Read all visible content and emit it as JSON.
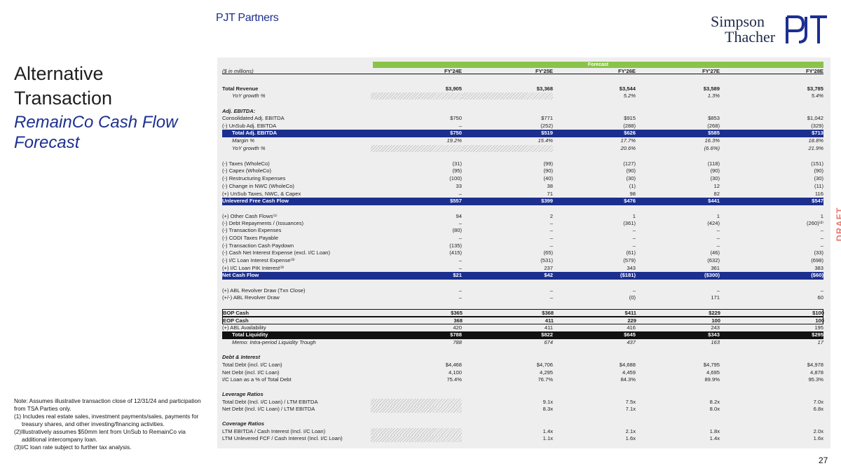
{
  "brand": {
    "pjt_name": "PJT Partners",
    "st_line1": "Simpson",
    "st_line2": "Thacher"
  },
  "heading": {
    "title": "Alternative Transaction",
    "subtitle": "RemainCo Cash Flow Forecast"
  },
  "draft": "DRAFT",
  "page_number": "27",
  "notes": {
    "intro": "Note: Assumes illustrative transaction close of 12/31/24 and participation from TSA Parties only.",
    "items": [
      "(1) Includes real estate sales, investment payments/sales, payments for treasury shares, and other investing/financing activities.",
      "(2)Illustratively assumes $50mm lent from UnSub to RemainCo via additional intercompany loan.",
      "(3)I/C loan rate subject to further tax analysis."
    ]
  },
  "table": {
    "forecast_label": "Forecast",
    "header": [
      "($ in millions)",
      "FY'24E",
      "FY'25E",
      "FY'26E",
      "FY'27E",
      "FY'28E"
    ],
    "rows": [
      {
        "label": "Total Revenue",
        "v": [
          "$3,905",
          "$3,368",
          "$3,544",
          "$3,589",
          "$3,785"
        ],
        "style": "bold"
      },
      {
        "label": "YoY growth %",
        "v": [
          "",
          "",
          "5.2%",
          "1.3%",
          "5.4%"
        ],
        "style": "italic-indent",
        "hatch": [
          0,
          1
        ]
      },
      {
        "label": "Adj. EBITDA:",
        "v": [
          "",
          "",
          "",
          "",
          ""
        ],
        "style": "bold-italic"
      },
      {
        "label": "Consolidated Adj. EBITDA",
        "v": [
          "$750",
          "$771",
          "$915",
          "$853",
          "$1,042"
        ]
      },
      {
        "label": "(-) UnSub Adj. EBITDA",
        "v": [
          "–",
          "(252)",
          "(288)",
          "(268)",
          "(329)"
        ]
      },
      {
        "label": "Total Adj. EBITDA",
        "v": [
          "$750",
          "$519",
          "$626",
          "$585",
          "$713"
        ],
        "style": "blue-indent"
      },
      {
        "label": "Margin %",
        "v": [
          "19.2%",
          "15.4%",
          "17.7%",
          "16.3%",
          "18.8%"
        ],
        "style": "italic-indent"
      },
      {
        "label": "YoY growth %",
        "v": [
          "",
          "",
          "20.6%",
          "(6.6%)",
          "21.9%"
        ],
        "style": "italic-indent",
        "hatch": [
          0,
          1
        ]
      },
      {
        "label": "(-) Taxes (WholeCo)",
        "v": [
          "(31)",
          "(99)",
          "(127)",
          "(118)",
          "(151)"
        ]
      },
      {
        "label": "(-) Capex (WholeCo)",
        "v": [
          "(95)",
          "(90)",
          "(90)",
          "(90)",
          "(90)"
        ]
      },
      {
        "label": "(-) Restructuring Expenses",
        "v": [
          "(100)",
          "(40)",
          "(30)",
          "(30)",
          "(30)"
        ]
      },
      {
        "label": "(-) Change in NWC (WholeCo)",
        "v": [
          "33",
          "38",
          "(1)",
          "12",
          "(11)"
        ]
      },
      {
        "label": "(+) UnSub Taxes, NWC, & Capex",
        "v": [
          "–",
          "71",
          "98",
          "82",
          "116"
        ]
      },
      {
        "label": "Unlevered Free Cash Flow",
        "v": [
          "$557",
          "$399",
          "$476",
          "$441",
          "$547"
        ],
        "style": "blue"
      },
      {
        "label": "(+) Other Cash Flows⁽¹⁾",
        "v": [
          "94",
          "2",
          "1",
          "1",
          "1"
        ]
      },
      {
        "label": "(-) Debt Repayments / (Issuances)",
        "v": [
          "–",
          "–",
          "(361)",
          "(424)",
          "(260)⁽²⁾"
        ]
      },
      {
        "label": "(-) Transaction Expenses",
        "v": [
          "(80)",
          "–",
          "–",
          "–",
          "–"
        ]
      },
      {
        "label": "(-) CODI Taxes Payable",
        "v": [
          "–",
          "–",
          "–",
          "–",
          "–"
        ]
      },
      {
        "label": "(-) Transaction Cash Paydown",
        "v": [
          "(135)",
          "–",
          "–",
          "–",
          "–"
        ]
      },
      {
        "label": "(-) Cash Net Interest Expense (excl. I/C Loan)",
        "v": [
          "(415)",
          "(65)",
          "(61)",
          "(46)",
          "(33)"
        ]
      },
      {
        "label": "(-) I/C Loan Interest Expense⁽³⁾",
        "v": [
          "–",
          "(531)",
          "(579)",
          "(632)",
          "(698)"
        ]
      },
      {
        "label": "(+) I/C Loan PIK Interest⁽³⁾",
        "v": [
          "–",
          "237",
          "343",
          "361",
          "383"
        ]
      },
      {
        "label": "Net Cash Flow",
        "v": [
          "$21",
          "$42",
          "($181)",
          "($300)",
          "($60)"
        ],
        "style": "blue"
      },
      {
        "label": "(+) ABL Revolver Draw (Txn Close)",
        "v": [
          "–",
          "–",
          "–",
          "–",
          "–"
        ]
      },
      {
        "label": "(+/-) ABL Revolver Draw",
        "v": [
          "–",
          "–",
          "(0)",
          "171",
          "60"
        ]
      },
      {
        "label": "BOP Cash",
        "v": [
          "$365",
          "$368",
          "$411",
          "$229",
          "$100"
        ],
        "style": "boxed"
      },
      {
        "label": "EOP Cash",
        "v": [
          "368",
          "411",
          "229",
          "100",
          "100"
        ],
        "style": "boxed"
      },
      {
        "label": "(+) ABL Availability",
        "v": [
          "420",
          "411",
          "416",
          "243",
          "195"
        ]
      },
      {
        "label": "Total Liquidity",
        "v": [
          "$788",
          "$822",
          "$645",
          "$343",
          "$295"
        ],
        "style": "black-indent"
      },
      {
        "label": "Memo: Intra-period Liquidity Trough",
        "v": [
          "788",
          "674",
          "437",
          "163",
          "17"
        ],
        "style": "italic-indent"
      },
      {
        "label": "Debt & Interest",
        "v": [
          "",
          "",
          "",
          "",
          ""
        ],
        "style": "bold-italic"
      },
      {
        "label": "Total Debt (incl. I/C Loan)",
        "v": [
          "$4,468",
          "$4,706",
          "$4,688",
          "$4,795",
          "$4,978"
        ]
      },
      {
        "label": "Net Debt (incl. I/C Loan)",
        "v": [
          "4,100",
          "4,295",
          "4,459",
          "4,695",
          "4,878"
        ]
      },
      {
        "label": "I/C Loan as a % of Total Debt",
        "v": [
          "75.4%",
          "76.7%",
          "84.3%",
          "89.9%",
          "95.3%"
        ]
      },
      {
        "label": "Leverage Ratios",
        "v": [
          "",
          "",
          "",
          "",
          ""
        ],
        "style": "bold-italic"
      },
      {
        "label": "Total Debt (Incl. I/C Loan) / LTM EBITDA",
        "v": [
          "",
          "9.1x",
          "7.5x",
          "8.2x",
          "7.0x"
        ],
        "hatch": [
          0
        ]
      },
      {
        "label": "Net Debt (Incl. I/C Loan) / LTM EBITDA",
        "v": [
          "",
          "8.3x",
          "7.1x",
          "8.0x",
          "6.8x"
        ],
        "hatch": [
          0
        ]
      },
      {
        "label": "Coverage Ratios",
        "v": [
          "",
          "",
          "",
          "",
          ""
        ],
        "style": "bold-italic"
      },
      {
        "label": "LTM EBITDA / Cash Interest (Incl. I/C Loan)",
        "v": [
          "",
          "1.4x",
          "2.1x",
          "1.8x",
          "2.0x"
        ],
        "hatch": [
          0
        ]
      },
      {
        "label": "LTM Unlevered FCF / Cash Interest (Incl. I/C Loan)",
        "v": [
          "",
          "1.1x",
          "1.6x",
          "1.4x",
          "1.6x"
        ],
        "hatch": [
          0
        ]
      }
    ]
  }
}
